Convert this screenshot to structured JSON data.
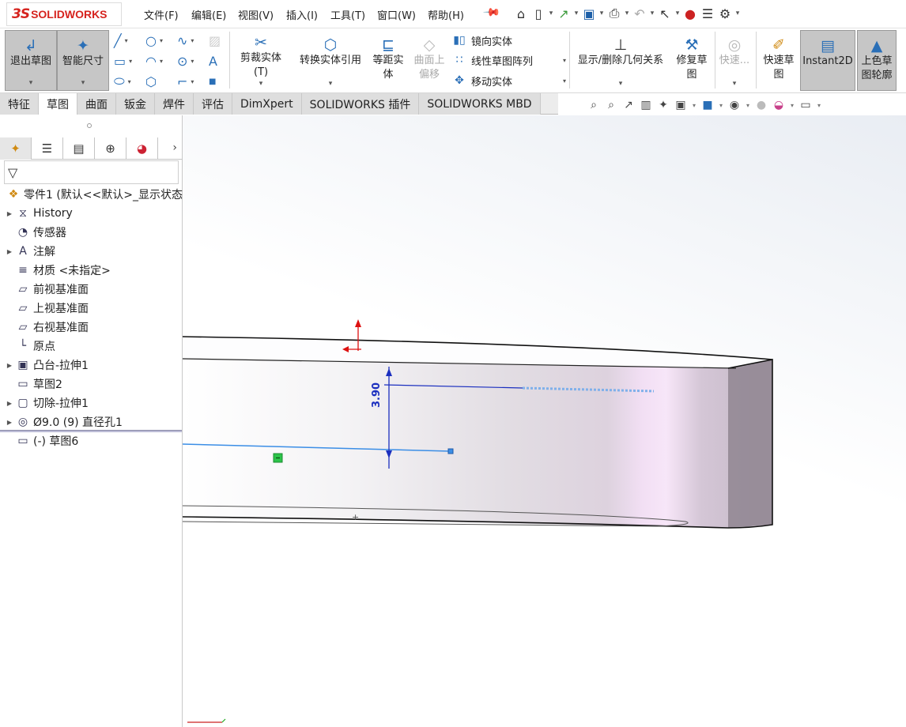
{
  "app": {
    "logo_ds": "3S",
    "logo_name": "SOLIDWORKS"
  },
  "menu": [
    "文件(F)",
    "编辑(E)",
    "视图(V)",
    "插入(I)",
    "工具(T)",
    "窗口(W)",
    "帮助(H)"
  ],
  "quick_tools": [
    "home-icon",
    "new-file-icon",
    "open-icon",
    "save-icon",
    "print-icon",
    "undo-icon",
    "select-icon",
    "rebuild-icon",
    "file-properties-icon",
    "options-icon"
  ],
  "commands": {
    "exit_sketch": "退出草图",
    "smart_dimension": "智能尺寸",
    "trim_entities": "剪裁实体(T)",
    "convert_entities": "转换实体引用",
    "offset_entities": "等距实体",
    "offset_on_surface": "曲面上偏移",
    "mirror_entities": "镜向实体",
    "linear_pattern": "线性草图阵列",
    "move_entities": "移动实体",
    "display_relations": "显示/删除几何关系",
    "repair_sketch": "修复草图",
    "quick_snaps": "快速...",
    "rapid_sketch": "快速草图",
    "instant2d": "Instant2D",
    "shaded_contours": "上色草图轮廓"
  },
  "tabs": [
    "特征",
    "草图",
    "曲面",
    "钣金",
    "焊件",
    "评估",
    "DimXpert",
    "SOLIDWORKS 插件",
    "SOLIDWORKS MBD"
  ],
  "active_tab": "草图",
  "tree": {
    "root": "零件1  (默认<<默认>_显示状态",
    "items": [
      {
        "label": "History",
        "icon": "history-icon",
        "expandable": true
      },
      {
        "label": "传感器",
        "icon": "sensor-icon",
        "expandable": false
      },
      {
        "label": "注解",
        "icon": "annotation-icon",
        "expandable": true
      },
      {
        "label": "材质 <未指定>",
        "icon": "material-icon",
        "expandable": false
      },
      {
        "label": "前视基准面",
        "icon": "plane-icon",
        "expandable": false
      },
      {
        "label": "上视基准面",
        "icon": "plane-icon",
        "expandable": false
      },
      {
        "label": "右视基准面",
        "icon": "plane-icon",
        "expandable": false
      },
      {
        "label": "原点",
        "icon": "origin-icon",
        "expandable": false
      },
      {
        "label": "凸台-拉伸1",
        "icon": "boss-extrude-icon",
        "expandable": true
      },
      {
        "label": "草图2",
        "icon": "sketch-icon",
        "expandable": false
      },
      {
        "label": "切除-拉伸1",
        "icon": "cut-extrude-icon",
        "expandable": true
      },
      {
        "label": "Ø9.0 (9) 直径孔1",
        "icon": "hole-icon",
        "expandable": true
      },
      {
        "label": "(-) 草图6",
        "icon": "sketch-icon",
        "expandable": false
      }
    ]
  },
  "dimension": {
    "value": "3.90",
    "color": "#1b2fbf"
  },
  "colors": {
    "accent": "#2a6fb7",
    "brand": "#d6231e",
    "sketch_line": "#3b8ee6",
    "part_shade": "#d9c8dc"
  }
}
